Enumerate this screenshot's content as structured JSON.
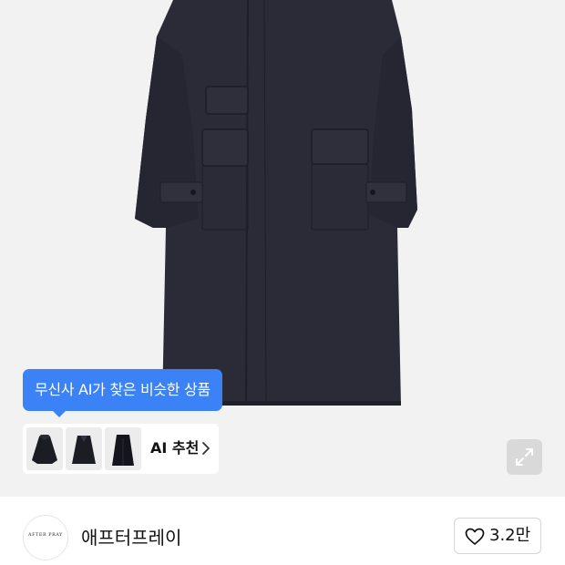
{
  "product_image": {
    "icon": "coat-product-photo"
  },
  "ai_recommendation": {
    "tooltip": "무신사 AI가 찾은 비슷한 상품",
    "label": "AI 추천",
    "thumbnails": [
      "coat-thumbnail-1",
      "coat-thumbnail-2",
      "coat-thumbnail-3"
    ],
    "chevron_icon": "chevron-right-icon"
  },
  "expand_button": {
    "icon": "expand-icon"
  },
  "brand": {
    "logo_text": "AFTER PRAY",
    "name": "애프터프레이"
  },
  "like": {
    "icon": "heart-icon",
    "count": "3.2만"
  },
  "colors": {
    "accent": "#3b82f6",
    "coat": "#2a2b36",
    "background": "#f2f2f2"
  }
}
